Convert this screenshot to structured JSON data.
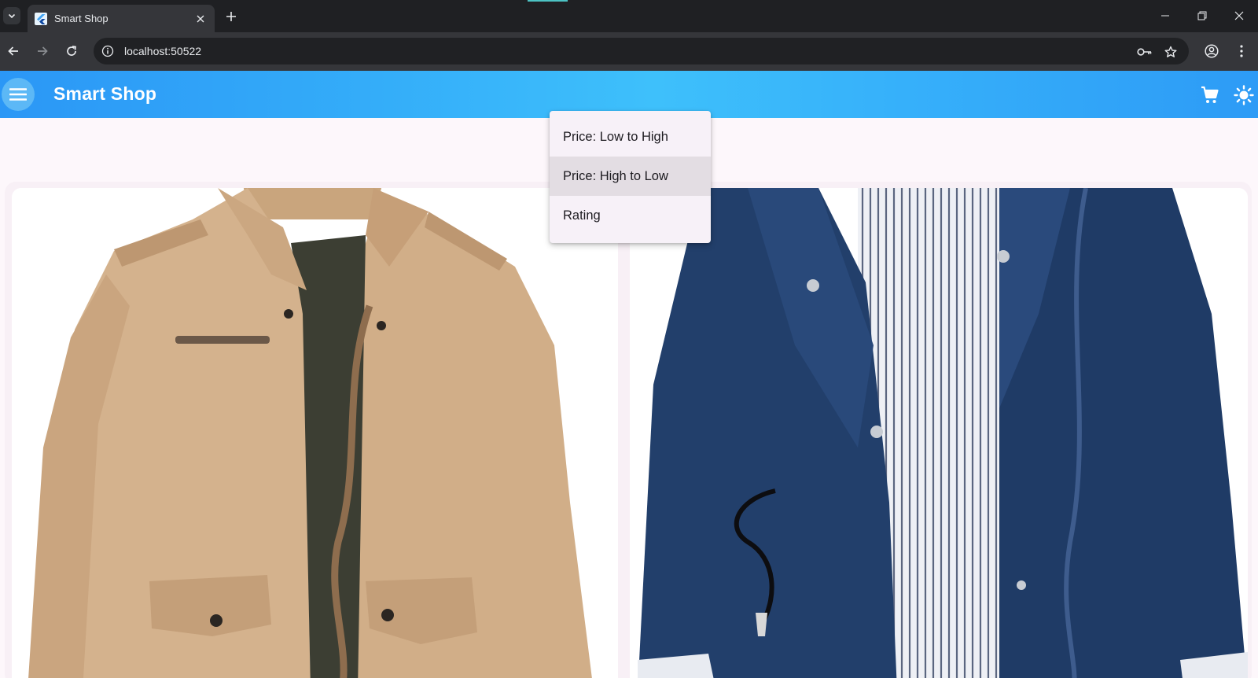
{
  "browser": {
    "tab_title": "Smart Shop",
    "url": "localhost:50522",
    "icons": [
      "tab-search-icon",
      "flutter-favicon-icon",
      "tab-close-icon",
      "new-tab-icon",
      "minimize-icon",
      "restore-icon",
      "close-window-icon",
      "back-icon",
      "forward-icon",
      "reload-icon",
      "site-info-icon",
      "password-key-icon",
      "bookmark-star-icon",
      "profile-icon",
      "more-menu-icon"
    ]
  },
  "appbar": {
    "title": "Smart Shop",
    "icons": [
      "menu-icon",
      "cart-icon",
      "light-mode-icon"
    ],
    "gradient": [
      "#2b97f6",
      "#3ec0fb",
      "#2d9bf6"
    ]
  },
  "sort_menu": {
    "items": [
      {
        "label": "Price: Low to High",
        "highlighted": false
      },
      {
        "label": "Price: High to Low",
        "highlighted": true
      },
      {
        "label": "Rating",
        "highlighted": false
      }
    ]
  },
  "products": [
    {
      "image": "khaki-jacket",
      "color": "#d1b08c"
    },
    {
      "image": "navy-jacket",
      "color": "#1f3f6e"
    }
  ]
}
